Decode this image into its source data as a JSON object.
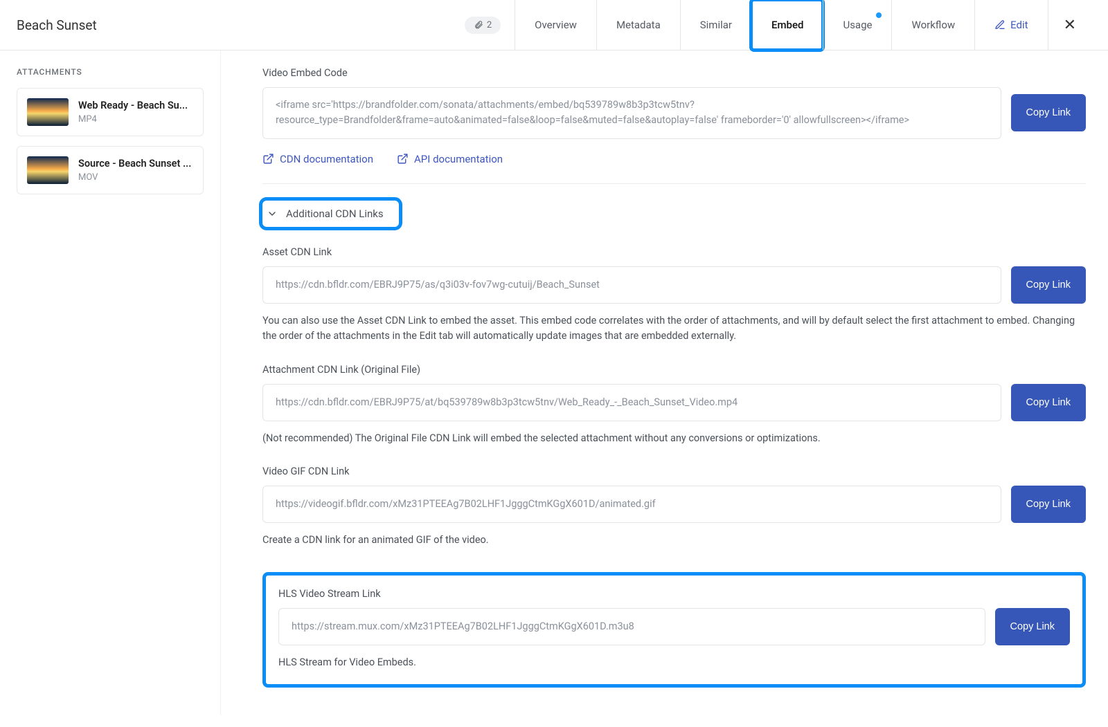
{
  "header": {
    "title": "Beach Sunset",
    "attachment_count": "2",
    "tabs": {
      "overview": "Overview",
      "metadata": "Metadata",
      "similar": "Similar",
      "embed": "Embed",
      "usage": "Usage",
      "workflow": "Workflow",
      "edit": "Edit",
      "close": "✕"
    }
  },
  "sidebar": {
    "heading": "ATTACHMENTS",
    "items": [
      {
        "title": "Web Ready - Beach Su...",
        "format": "MP4"
      },
      {
        "title": "Source - Beach Sunset ...",
        "format": "MOV"
      }
    ]
  },
  "embed": {
    "video_embed": {
      "label": "Video Embed Code",
      "value": "<iframe src='https://brandfolder.com/sonata/attachments/embed/bq539789w8b3p3tcw5tnv?resource_type=Brandfolder&frame=auto&animated=false&loop=false&muted=false&autoplay=false' frameborder='0' allowfullscreen></iframe>",
      "copy": "Copy Link"
    },
    "doc_links": {
      "cdn": "CDN documentation",
      "api": "API documentation"
    },
    "additional_toggle": "Additional CDN Links",
    "asset_cdn": {
      "label": "Asset CDN Link",
      "value": "https://cdn.bfldr.com/EBRJ9P75/as/q3i03v-fov7wg-cutuij/Beach_Sunset",
      "copy": "Copy Link",
      "helper": "You can also use the Asset CDN Link to embed the asset. This embed code correlates with the order of attachments, and will by default select the first attachment to embed. Changing the order of the attachments in the Edit tab will automatically update images that are embedded externally."
    },
    "attachment_cdn": {
      "label": "Attachment CDN Link (Original File)",
      "value": "https://cdn.bfldr.com/EBRJ9P75/at/bq539789w8b3p3tcw5tnv/Web_Ready_-_Beach_Sunset_Video.mp4",
      "copy": "Copy Link",
      "helper": "(Not recommended) The Original File CDN Link will embed the selected attachment without any conversions or optimizations."
    },
    "gif_cdn": {
      "label": "Video GIF CDN Link",
      "value": "https://videogif.bfldr.com/xMz31PTEEAg7B02LHF1JgggCtmKGgX601D/animated.gif",
      "copy": "Copy Link",
      "helper": "Create a CDN link for an animated GIF of the video."
    },
    "hls": {
      "label": "HLS Video Stream Link",
      "value": "https://stream.mux.com/xMz31PTEEAg7B02LHF1JgggCtmKGgX601D.m3u8",
      "copy": "Copy Link",
      "helper": "HLS Stream for Video Embeds."
    }
  }
}
